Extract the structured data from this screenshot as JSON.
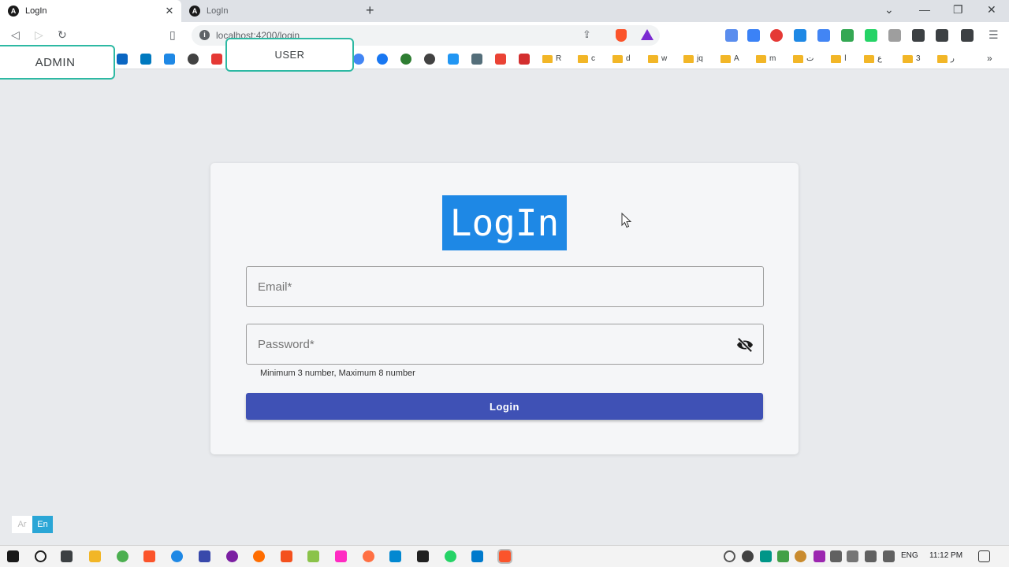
{
  "browser": {
    "tabs": [
      {
        "title": "LogIn",
        "favicon": "A",
        "active": true
      },
      {
        "title": "LogIn",
        "favicon": "A",
        "active": false
      }
    ],
    "new_tab": "+",
    "url": "localhost:4200/login",
    "bookmark_folders": [
      "R",
      "c",
      "d",
      "w",
      "jq",
      "A",
      "m",
      "ت",
      "ا",
      "ع",
      "3",
      "ر"
    ],
    "more": "»"
  },
  "roles": {
    "admin_label": "ADMIN",
    "user_label": "USER"
  },
  "login": {
    "heading": "LogIn",
    "email_placeholder": "Email*",
    "password_placeholder": "Password*",
    "password_hint": "Minimum 3 number, Maximum 8 number",
    "submit_label": "Login"
  },
  "language": {
    "options": [
      "Ar",
      "En"
    ],
    "selected": "En"
  },
  "taskbar": {
    "language": "ENG",
    "time": "11:12 PM"
  },
  "colors": {
    "accent_teal": "#2db9a3",
    "heading_highlight": "#1e88e5",
    "primary_button": "#3f51b5",
    "lang_active": "#2aa6d6"
  }
}
